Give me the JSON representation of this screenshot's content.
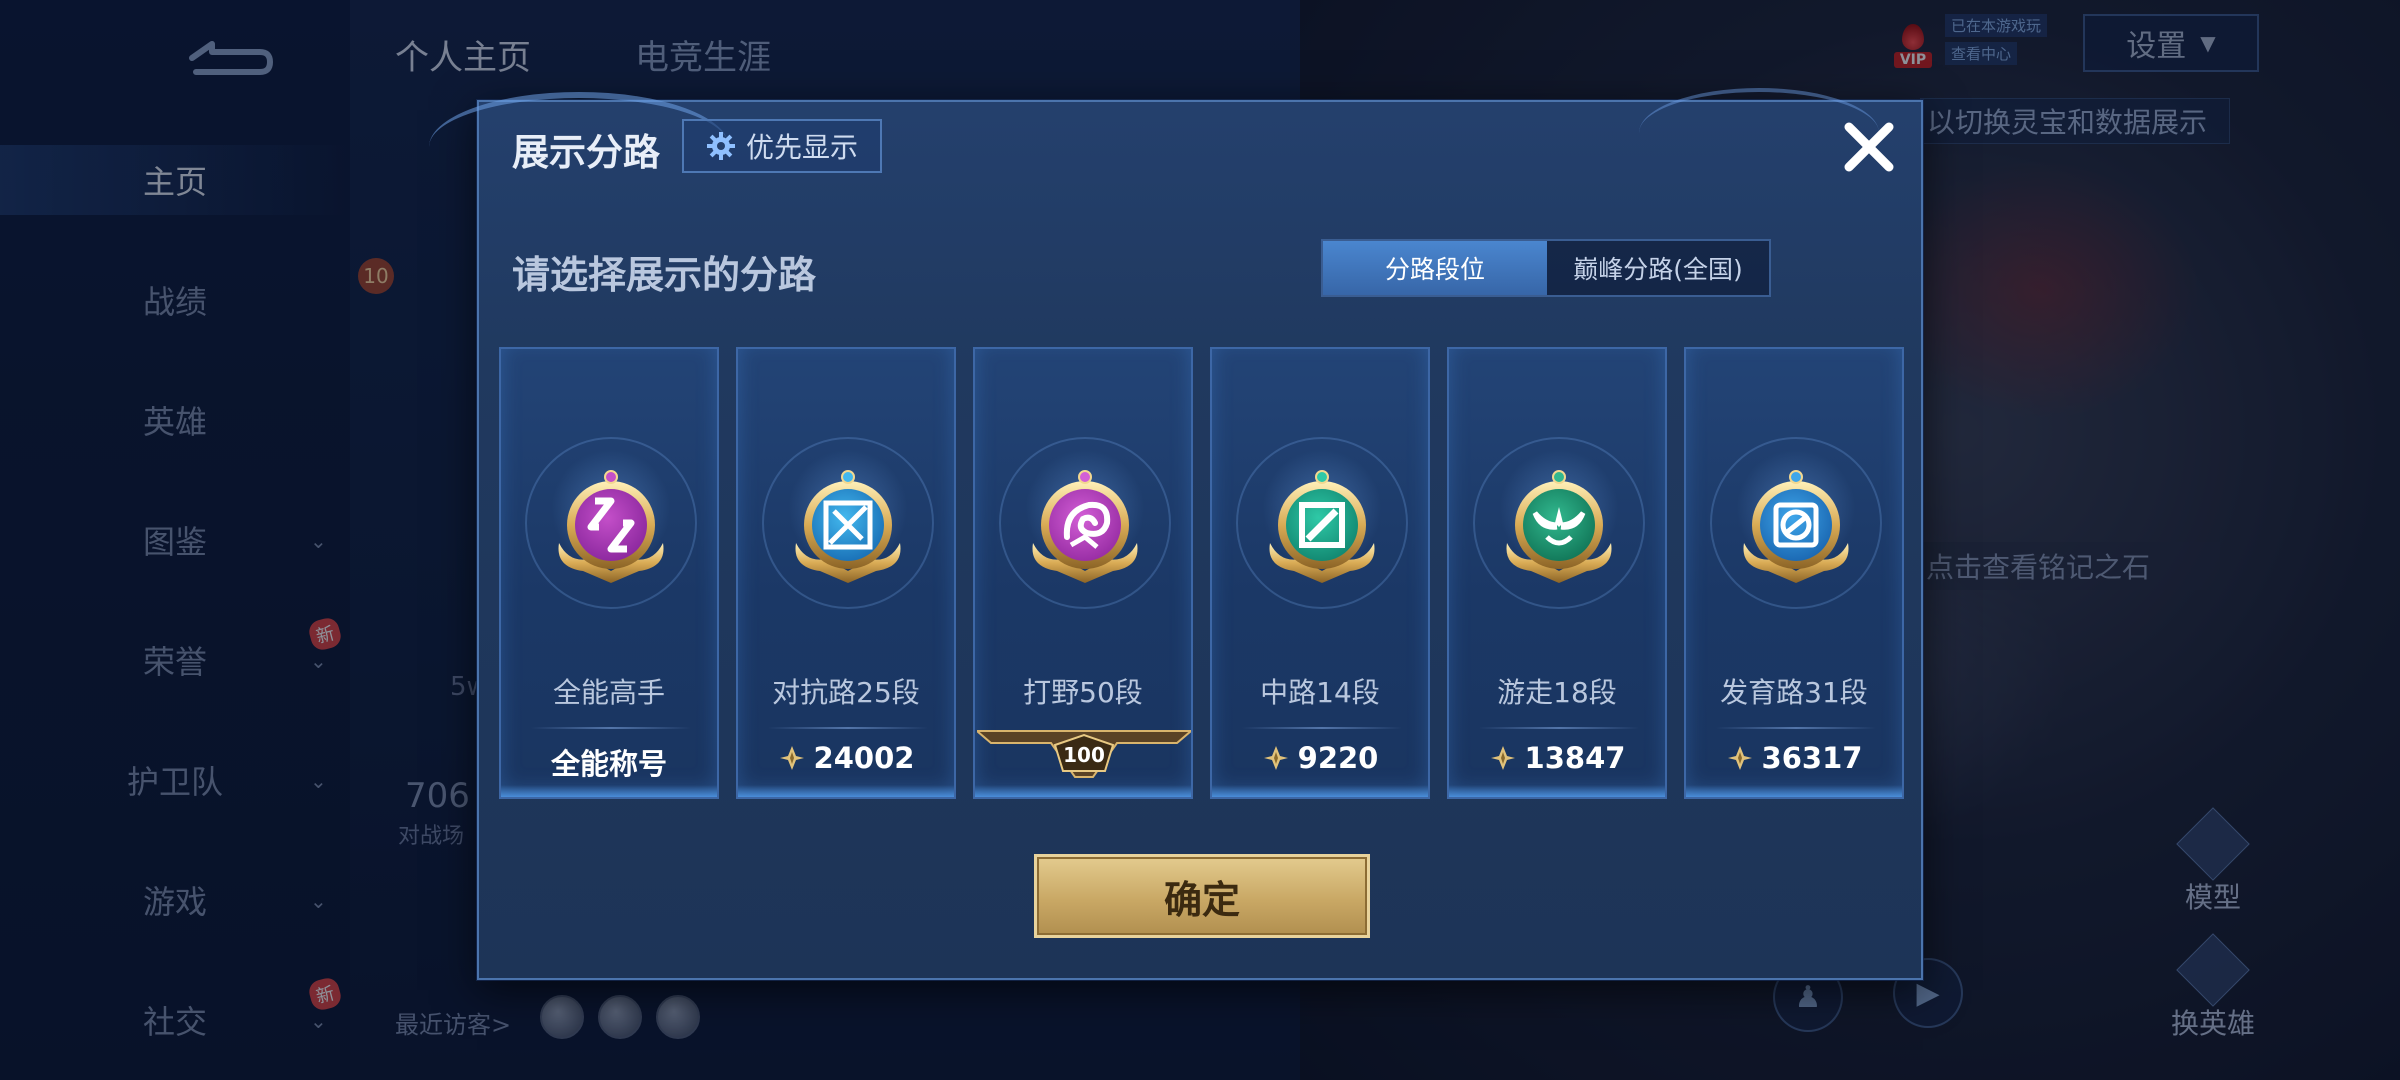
{
  "background": {
    "sidebar_items": [
      {
        "label": "主页",
        "has_chevron": false,
        "has_new": false
      },
      {
        "label": "战绩",
        "has_chevron": false,
        "has_new": false
      },
      {
        "label": "英雄",
        "has_chevron": false,
        "has_new": false
      },
      {
        "label": "图鉴",
        "has_chevron": true,
        "has_new": false
      },
      {
        "label": "荣誉",
        "has_chevron": true,
        "has_new": true
      },
      {
        "label": "护卫队",
        "has_chevron": true,
        "has_new": false
      },
      {
        "label": "游戏",
        "has_chevron": true,
        "has_new": false
      },
      {
        "label": "社交",
        "has_chevron": true,
        "has_new": true
      }
    ],
    "new_badge": "新",
    "top_tabs": [
      "个人主页",
      "电竞生涯"
    ],
    "settings_label": "设置",
    "vip_label": "VIP",
    "vip_tip_1": "已在本游戏玩",
    "vip_tip_2": "查看中心",
    "hint_top_right": "以切换灵宝和数据展示",
    "hint_mid_right": "点击查看铭记之石",
    "model_label": "模型",
    "change_hero_label": "换英雄",
    "recent_visitors_label": "最近访客>",
    "bg_level": "10",
    "bg_stat_number": "706",
    "bg_stat_label": "对战场",
    "bg_5w": "5w"
  },
  "modal": {
    "title": "展示分路",
    "priority_button_label": "优先显示",
    "prompt": "请选择展示的分路",
    "tabs": [
      {
        "label": "分路段位",
        "active": true
      },
      {
        "label": "巅峰分路(全国)",
        "active": false
      }
    ],
    "cards": [
      {
        "label": "全能高手",
        "value": "全能称号",
        "value_has_icon": false,
        "badge_color": "#c44fc9",
        "badge_inner": "#8e2aa0",
        "icon": "allround-icon"
      },
      {
        "label": "对抗路25段",
        "value": "24002",
        "value_has_icon": true,
        "badge_color": "#43b8ee",
        "badge_inner": "#1b73b9",
        "icon": "clash-lane-icon"
      },
      {
        "label": "打野50段",
        "value": "100",
        "value_has_icon": false,
        "rank_plate": true,
        "badge_color": "#d35fd6",
        "badge_inner": "#9a2fa6",
        "icon": "jungle-dragon-icon"
      },
      {
        "label": "中路14段",
        "value": "9220",
        "value_has_icon": true,
        "badge_color": "#2fc9a7",
        "badge_inner": "#138a73",
        "icon": "mid-lane-icon"
      },
      {
        "label": "游走18段",
        "value": "13847",
        "value_has_icon": true,
        "badge_color": "#32b98f",
        "badge_inner": "#137a5b",
        "icon": "roam-wings-icon"
      },
      {
        "label": "发育路31段",
        "value": "36317",
        "value_has_icon": true,
        "badge_color": "#3fa6ea",
        "badge_inner": "#1c6ab4",
        "icon": "farm-lane-icon"
      }
    ],
    "confirm_label": "确定"
  }
}
